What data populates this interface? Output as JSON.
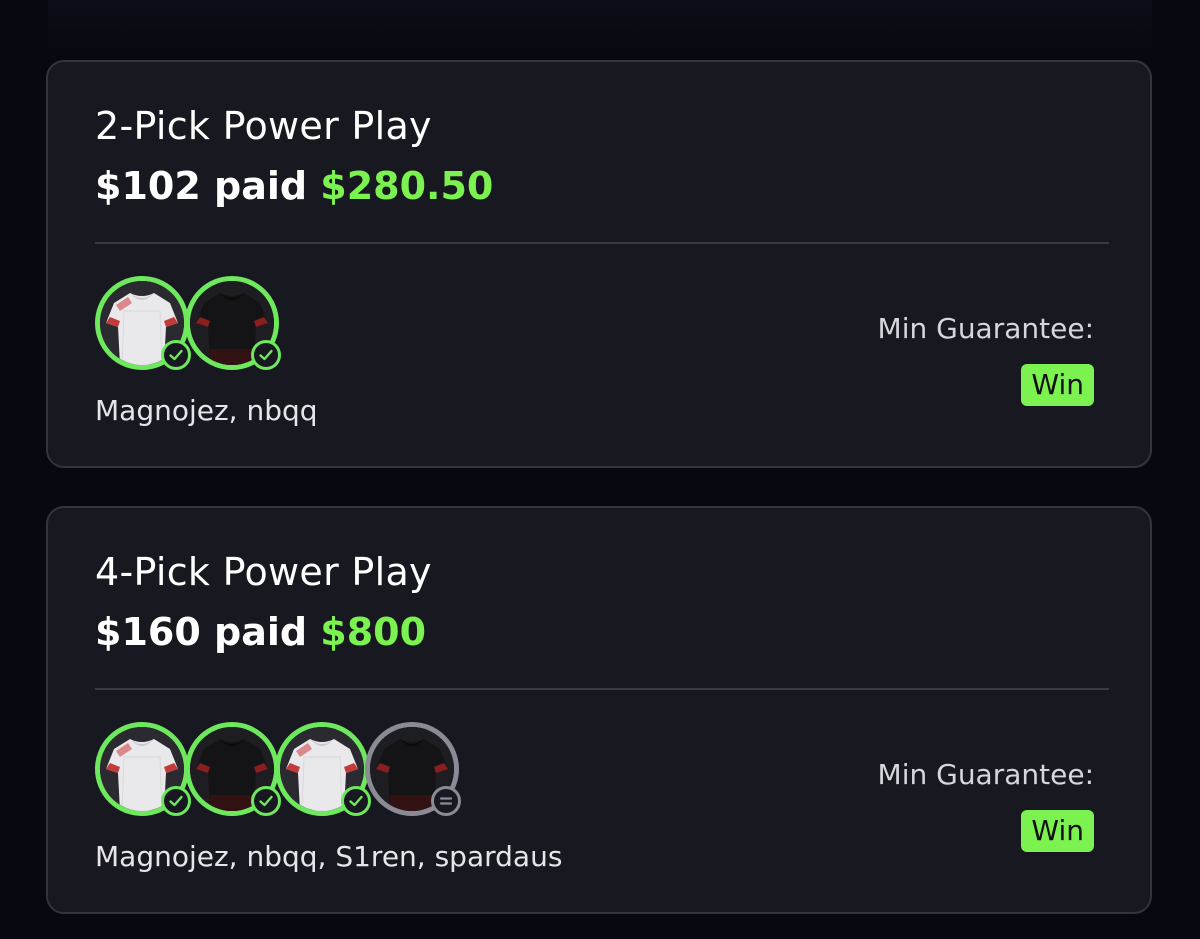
{
  "cards": [
    {
      "title": "2-Pick Power Play",
      "paid": "$102 paid",
      "payout": "$280.50",
      "players": "Magnojez, nbqq",
      "guarantee_label": "Min Guarantee:",
      "guarantee_value": "Win",
      "picks": [
        {
          "jersey": "white",
          "status": "won"
        },
        {
          "jersey": "black",
          "status": "won"
        }
      ]
    },
    {
      "title": "4-Pick Power Play",
      "paid": "$160 paid",
      "payout": "$800",
      "players": "Magnojez, nbqq, S1ren, spardaus",
      "guarantee_label": "Min Guarantee:",
      "guarantee_value": "Win",
      "picks": [
        {
          "jersey": "white",
          "status": "won"
        },
        {
          "jersey": "black",
          "status": "won"
        },
        {
          "jersey": "white",
          "status": "won"
        },
        {
          "jersey": "black",
          "status": "push"
        }
      ]
    }
  ],
  "colors": {
    "accent_green": "#7cf251",
    "ring_green": "#6ee85c",
    "ring_gray": "#8a8b94",
    "card_bg": "#181820",
    "page_bg": "#06090f"
  },
  "icons": {
    "won": "check-circle-icon",
    "push": "equals-circle-icon",
    "jersey": "jersey-icon"
  }
}
